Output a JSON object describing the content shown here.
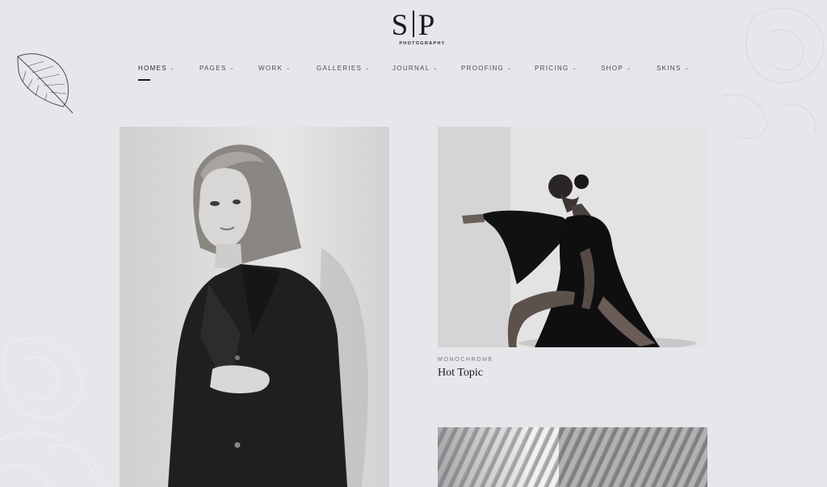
{
  "logo": {
    "mark_left": "S",
    "mark_right": "P",
    "subtitle": "PHOTOGRAPHY"
  },
  "nav": {
    "items": [
      {
        "label": "HOMES",
        "active": true
      },
      {
        "label": "PAGES"
      },
      {
        "label": "WORK"
      },
      {
        "label": "GALLERIES"
      },
      {
        "label": "JOURNAL"
      },
      {
        "label": "PROOFING"
      },
      {
        "label": "PRICING"
      },
      {
        "label": "SHOP"
      },
      {
        "label": "SKINS"
      }
    ],
    "chevron": "⌄"
  },
  "posts": [
    {
      "image": "portrait-woman-black-coat"
    },
    {
      "image": "dancer-black-gown",
      "category": "MONOCHROME",
      "title": "Hot Topic"
    },
    {
      "image": "striped-shadow-abstract"
    }
  ],
  "colors": {
    "background": "#e6e7eb",
    "text": "#1d1d1f",
    "muted": "#76787e"
  }
}
